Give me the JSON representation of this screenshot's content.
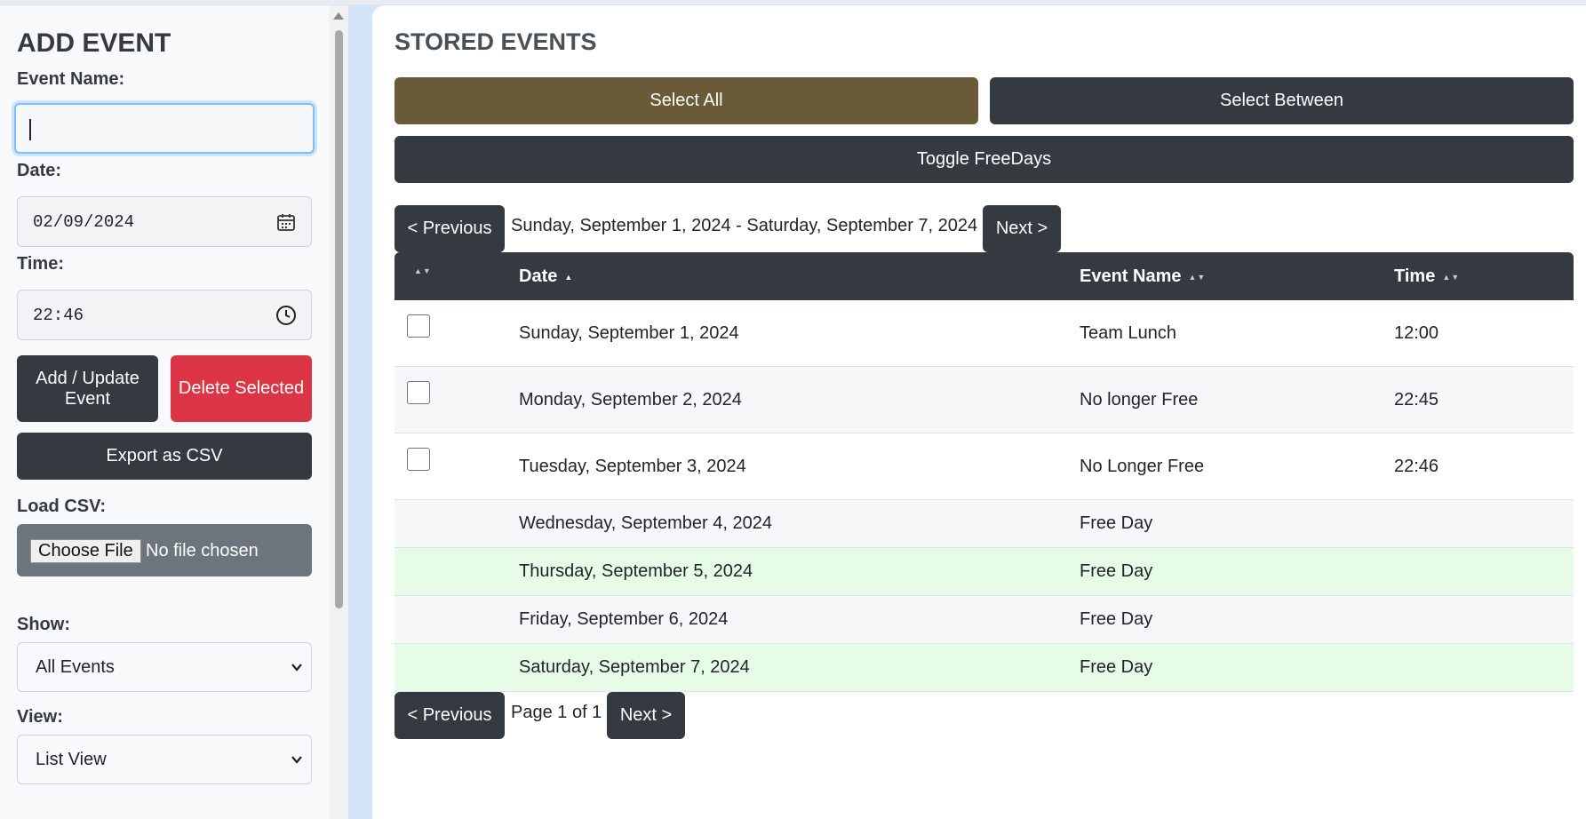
{
  "sidebar": {
    "title": "ADD EVENT",
    "event_name_label": "Event Name:",
    "event_name_value": "",
    "date_label": "Date:",
    "date_value": "02/09/2024",
    "time_label": "Time:",
    "time_value": "22:46",
    "add_update_label": "Add / Update Event",
    "delete_selected_label": "Delete Selected",
    "export_csv_label": "Export as CSV",
    "load_csv_label": "Load CSV:",
    "choose_file_label": "Choose File",
    "file_status": "No file chosen",
    "show_label": "Show:",
    "show_value": "All Events",
    "view_label": "View:",
    "view_value": "List View",
    "icons": [
      "calendar-icon",
      "clock-icon",
      "chevron-down-icon"
    ]
  },
  "main": {
    "title": "STORED EVENTS",
    "select_all_label": "Select All",
    "select_between_label": "Select Between",
    "toggle_freedays_label": "Toggle FreeDays",
    "prev_label": "< Previous",
    "next_label": "Next >",
    "range_text": "Sunday, September 1, 2024 - Saturday, September 7, 2024",
    "page_info": "Page 1 of 1",
    "table": {
      "columns": [
        "Date",
        "Event Name",
        "Time"
      ],
      "rows": [
        {
          "date": "Sunday, September 1, 2024",
          "name": "Team Lunch",
          "time": "12:00",
          "selectable": true
        },
        {
          "date": "Monday, September 2, 2024",
          "name": "No longer Free",
          "time": "22:45",
          "selectable": true
        },
        {
          "date": "Tuesday, September 3, 2024",
          "name": "No Longer Free",
          "time": "22:46",
          "selectable": true
        },
        {
          "date": "Wednesday, September 4, 2024",
          "name": "Free Day",
          "time": "",
          "selectable": false
        },
        {
          "date": "Thursday, September 5, 2024",
          "name": "Free Day",
          "time": "",
          "selectable": false
        },
        {
          "date": "Friday, September 6, 2024",
          "name": "Free Day",
          "time": "",
          "selectable": false
        },
        {
          "date": "Saturday, September 7, 2024",
          "name": "Free Day",
          "time": "",
          "selectable": false
        }
      ]
    }
  },
  "colors": {
    "dark": "#343a40",
    "danger": "#dc3545",
    "brown": "#6b5a37",
    "free_day_green": "#e6fce6",
    "stripe": "#f6f7f9",
    "background": "#d6e4f7"
  }
}
